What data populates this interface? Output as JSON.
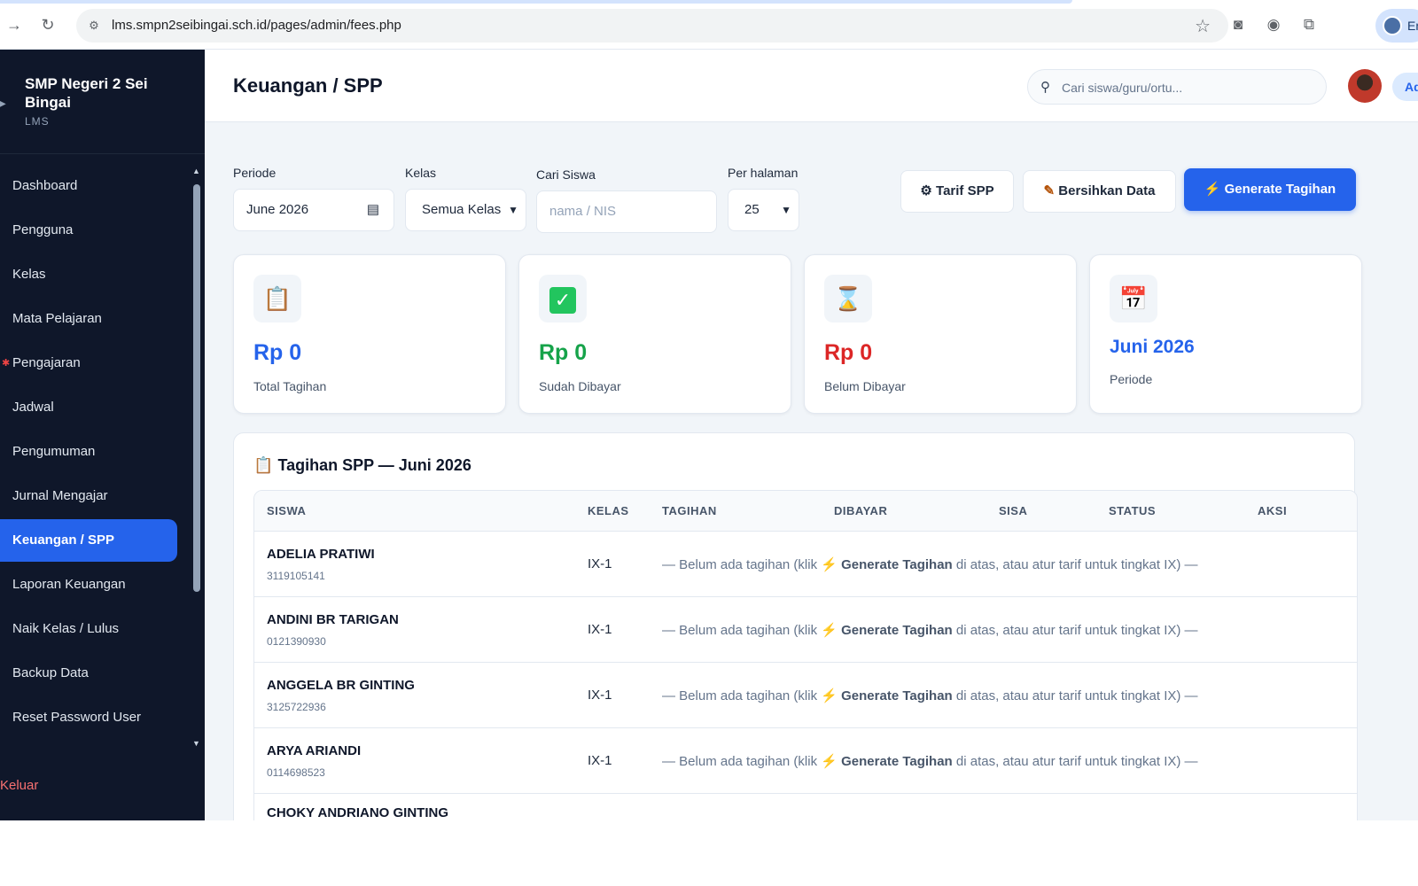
{
  "browser": {
    "url": "lms.smpn2seibingai.sch.id/pages/admin/fees.php",
    "profile_label": "En"
  },
  "sidebar": {
    "school_name": "SMP Negeri 2 Sei Bingai",
    "app_label": "LMS",
    "items": [
      {
        "label": "Dashboard"
      },
      {
        "label": "Pengguna"
      },
      {
        "label": "Kelas"
      },
      {
        "label": "Mata Pelajaran"
      },
      {
        "label": "Pengajaran"
      },
      {
        "label": "Jadwal"
      },
      {
        "label": "Pengumuman"
      },
      {
        "label": "Jurnal Mengajar"
      },
      {
        "label": "Keuangan / SPP",
        "active": true
      },
      {
        "label": "Laporan Keuangan"
      },
      {
        "label": "Naik Kelas / Lulus"
      },
      {
        "label": "Backup Data"
      },
      {
        "label": "Reset Password User"
      }
    ],
    "logout_label": "Keluar"
  },
  "header": {
    "title": "Keuangan / SPP",
    "search_placeholder": "Cari siswa/guru/ortu...",
    "user_label": "Adm"
  },
  "filters": {
    "periode_label": "Periode",
    "periode_value": "June 2026",
    "kelas_label": "Kelas",
    "kelas_value": "Semua Kelas",
    "cari_label": "Cari Siswa",
    "cari_placeholder": "nama / NIS",
    "perhal_label": "Per halaman",
    "perhal_value": "25"
  },
  "actions": {
    "tarif": "Tarif SPP",
    "bersihkan": "Bersihkan Data",
    "generate": "Generate Tagihan"
  },
  "stats": [
    {
      "value": "Rp 0",
      "label": "Total Tagihan",
      "icon": "clipboard-icon",
      "color": "#2563eb"
    },
    {
      "value": "Rp 0",
      "label": "Sudah Dibayar",
      "icon": "check-box-icon",
      "color": "#16a34a"
    },
    {
      "value": "Rp 0",
      "label": "Belum Dibayar",
      "icon": "hourglass-icon",
      "color": "#dc2626"
    },
    {
      "value": "Juni 2026",
      "label": "Periode",
      "icon": "calendar-icon",
      "color": "#2563eb"
    }
  ],
  "table": {
    "title": "Tagihan SPP — Juni 2026",
    "columns": [
      "SISWA",
      "KELAS",
      "TAGIHAN",
      "DIBAYAR",
      "SISA",
      "STATUS",
      "AKSI"
    ],
    "empty_prefix": "— Belum ada tagihan (klik",
    "empty_link": "Generate Tagihan",
    "empty_suffix": "di atas, atau atur tarif untuk tingkat IX) —",
    "rows": [
      {
        "name": "ADELIA PRATIWI",
        "nis": "3119105141",
        "kelas": "IX-1"
      },
      {
        "name": "ANDINI BR TARIGAN",
        "nis": "0121390930",
        "kelas": "IX-1"
      },
      {
        "name": "ANGGELA BR GINTING",
        "nis": "3125722936",
        "kelas": "IX-1"
      },
      {
        "name": "ARYA ARIANDI",
        "nis": "0114698523",
        "kelas": "IX-1"
      },
      {
        "name": "CHOKY ANDRIANO GINTING",
        "nis": "",
        "kelas": ""
      }
    ]
  }
}
